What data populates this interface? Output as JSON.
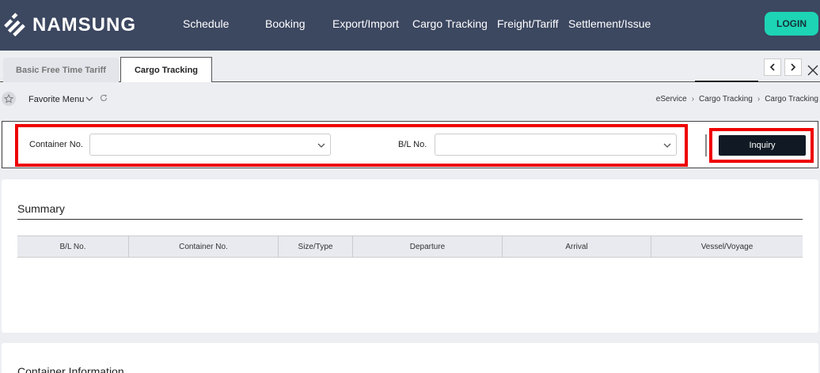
{
  "header": {
    "logo_text": "NAMSUNG",
    "nav": [
      "Schedule",
      "Booking",
      "Export/Import",
      "Cargo Tracking",
      "Freight/Tariff",
      "Settlement/Issue"
    ],
    "login_label": "LOGIN"
  },
  "tabs": [
    {
      "label": "Basic Free Time Tariff",
      "active": false
    },
    {
      "label": "Cargo Tracking",
      "active": true
    }
  ],
  "favorites": {
    "label": "Favorite Menu",
    "breadcrumb": [
      "eService",
      "Cargo Tracking",
      "Cargo Tracking"
    ]
  },
  "search": {
    "container_label": "Container No.",
    "container_value": "",
    "bl_label": "B/L No.",
    "bl_value": "",
    "inquiry_label": "Inquiry"
  },
  "summary": {
    "title": "Summary",
    "columns": [
      "B/L No.",
      "Container No.",
      "Size/Type",
      "Departure",
      "Arrival",
      "Vessel/Voyage"
    ]
  },
  "container_info": {
    "title": "Container Information"
  },
  "colors": {
    "header_bg": "#3c4760",
    "login_bg": "#1dd4b4",
    "highlight": "#ee0000",
    "inquiry_bg": "#111a24"
  }
}
